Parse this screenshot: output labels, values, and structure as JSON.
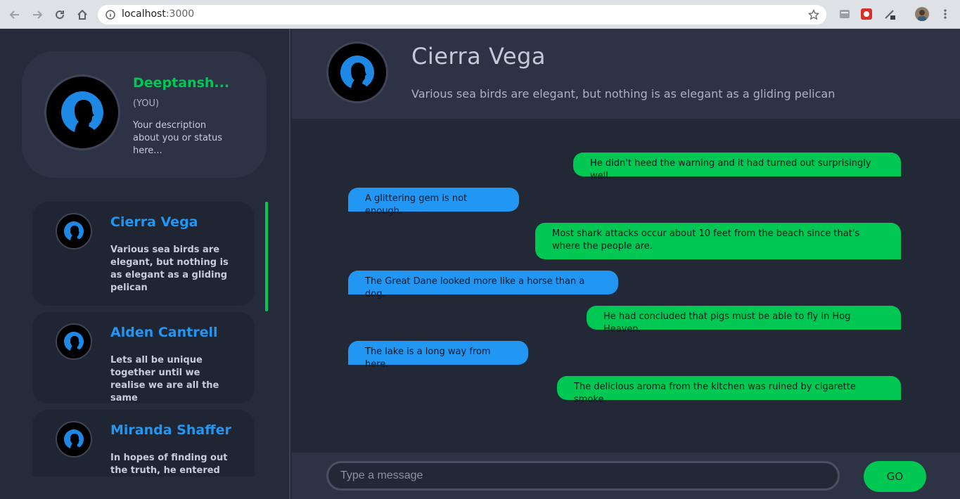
{
  "browser": {
    "url_host": "localhost",
    "url_port": ":3000"
  },
  "profile": {
    "name": "Deeptansh...",
    "you_label": "(YOU)",
    "description": "Your description about you or status here..."
  },
  "contacts": [
    {
      "name": "Cierra Vega",
      "status": "Various sea birds are elegant, but nothing is as elegant as a gliding pelican"
    },
    {
      "name": "Alden Cantrell",
      "status": "Lets all be unique together until we realise we are all the same"
    },
    {
      "name": "Miranda Shaffer",
      "status": "In hopes of finding out the truth, he entered the"
    }
  ],
  "chat": {
    "name": "Cierra Vega",
    "status": "Various sea birds are elegant, but nothing is as elegant as a gliding pelican",
    "messages": [
      {
        "direction": "sent",
        "text": "He didn't heed the warning and it had turned out surprisingly well."
      },
      {
        "direction": "received",
        "text": "A glittering gem is not enough."
      },
      {
        "direction": "sent",
        "text": "Most shark attacks occur about 10 feet from the beach since that's where the people are."
      },
      {
        "direction": "received",
        "text": "The Great Dane looked more like a horse than a dog."
      },
      {
        "direction": "sent",
        "text": "He had concluded that pigs must be able to fly in Hog Heaven."
      },
      {
        "direction": "received",
        "text": "The lake is a long way from here."
      },
      {
        "direction": "sent",
        "text": "The delicious aroma from the kitchen was ruined by cigarette smoke."
      }
    ]
  },
  "composer": {
    "placeholder": "Type a message",
    "send_label": "GO"
  },
  "colors": {
    "sent_bubble": "#00c853",
    "received_bubble": "#2196f3",
    "contact_name": "#2196f3",
    "profile_name": "#00c853"
  }
}
